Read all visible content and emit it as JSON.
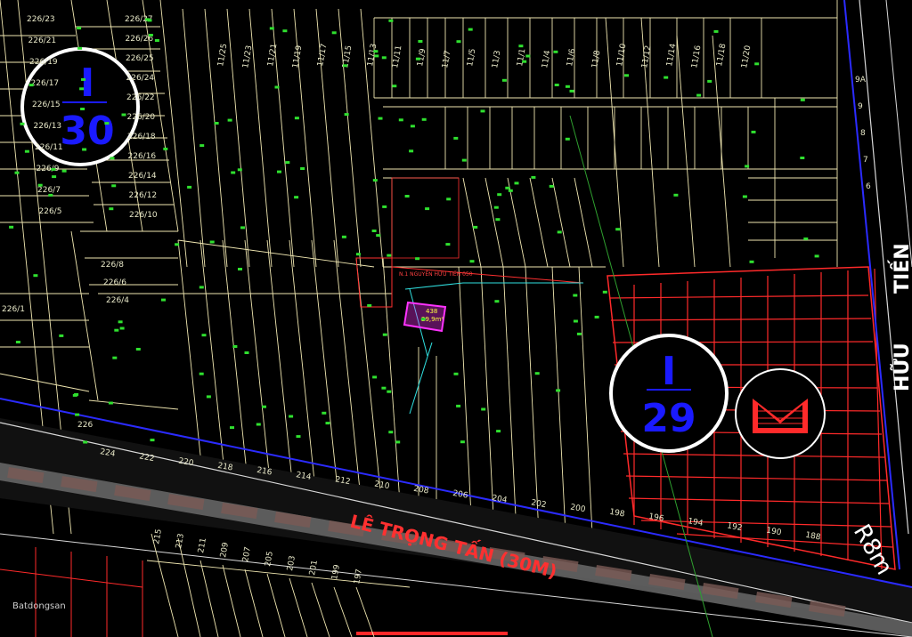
{
  "street_labels": {
    "le_trong_tan": "LÊ TRỌNG TẤN (30M)",
    "nguyen_huu_tien": "TIẾN",
    "nguyen_huu_tien_2": "HỮU",
    "r8m": "R8m"
  },
  "zones": {
    "zone_30": {
      "top": "I",
      "bottom": "30"
    },
    "zone_29": {
      "top": "I",
      "bottom": "29"
    }
  },
  "highlight": {
    "label": "29,9m²",
    "lot": "438",
    "road_note": "N.1 NGUYỄN HỮU TIẾN 050"
  },
  "left_lots": [
    "226/23",
    "226/21",
    "226/19",
    "226/17",
    "226/15",
    "226/13",
    "226/11",
    "226/9",
    "226/7",
    "226/5",
    "226/27",
    "226/26",
    "226/25",
    "226/24",
    "226/22",
    "226/20",
    "226/18",
    "226/16",
    "226/14",
    "226/12",
    "226/10",
    "226/8",
    "226/6",
    "226/4",
    "226/1",
    "226"
  ],
  "top_lots": [
    "11/25",
    "11/23",
    "11/21",
    "11/19",
    "11/17",
    "11/15",
    "11/13",
    "11/11",
    "11/9",
    "11/7",
    "11/5",
    "11/3",
    "11/1",
    "11/4",
    "11/6",
    "11/8",
    "11/10",
    "11/12",
    "11/14",
    "11/16",
    "11/18",
    "11/20"
  ],
  "street_lots": [
    "224",
    "222",
    "220",
    "218",
    "216",
    "214",
    "212",
    "210",
    "208",
    "206",
    "204",
    "202",
    "200",
    "198",
    "196",
    "194",
    "192",
    "190",
    "188"
  ],
  "bottom_lots": [
    "215",
    "213",
    "211",
    "209",
    "207",
    "205",
    "203",
    "201",
    "199",
    "197"
  ],
  "right_numbers": [
    "9A",
    "9",
    "8",
    "7",
    "6"
  ],
  "colors": {
    "background": "#000000",
    "plot_line": "#efe6b0",
    "street_red": "#ff2a2a",
    "road_blue": "#2b2bff",
    "zone_blue": "#1a1aff"
  },
  "watermark": "Batdongsan"
}
